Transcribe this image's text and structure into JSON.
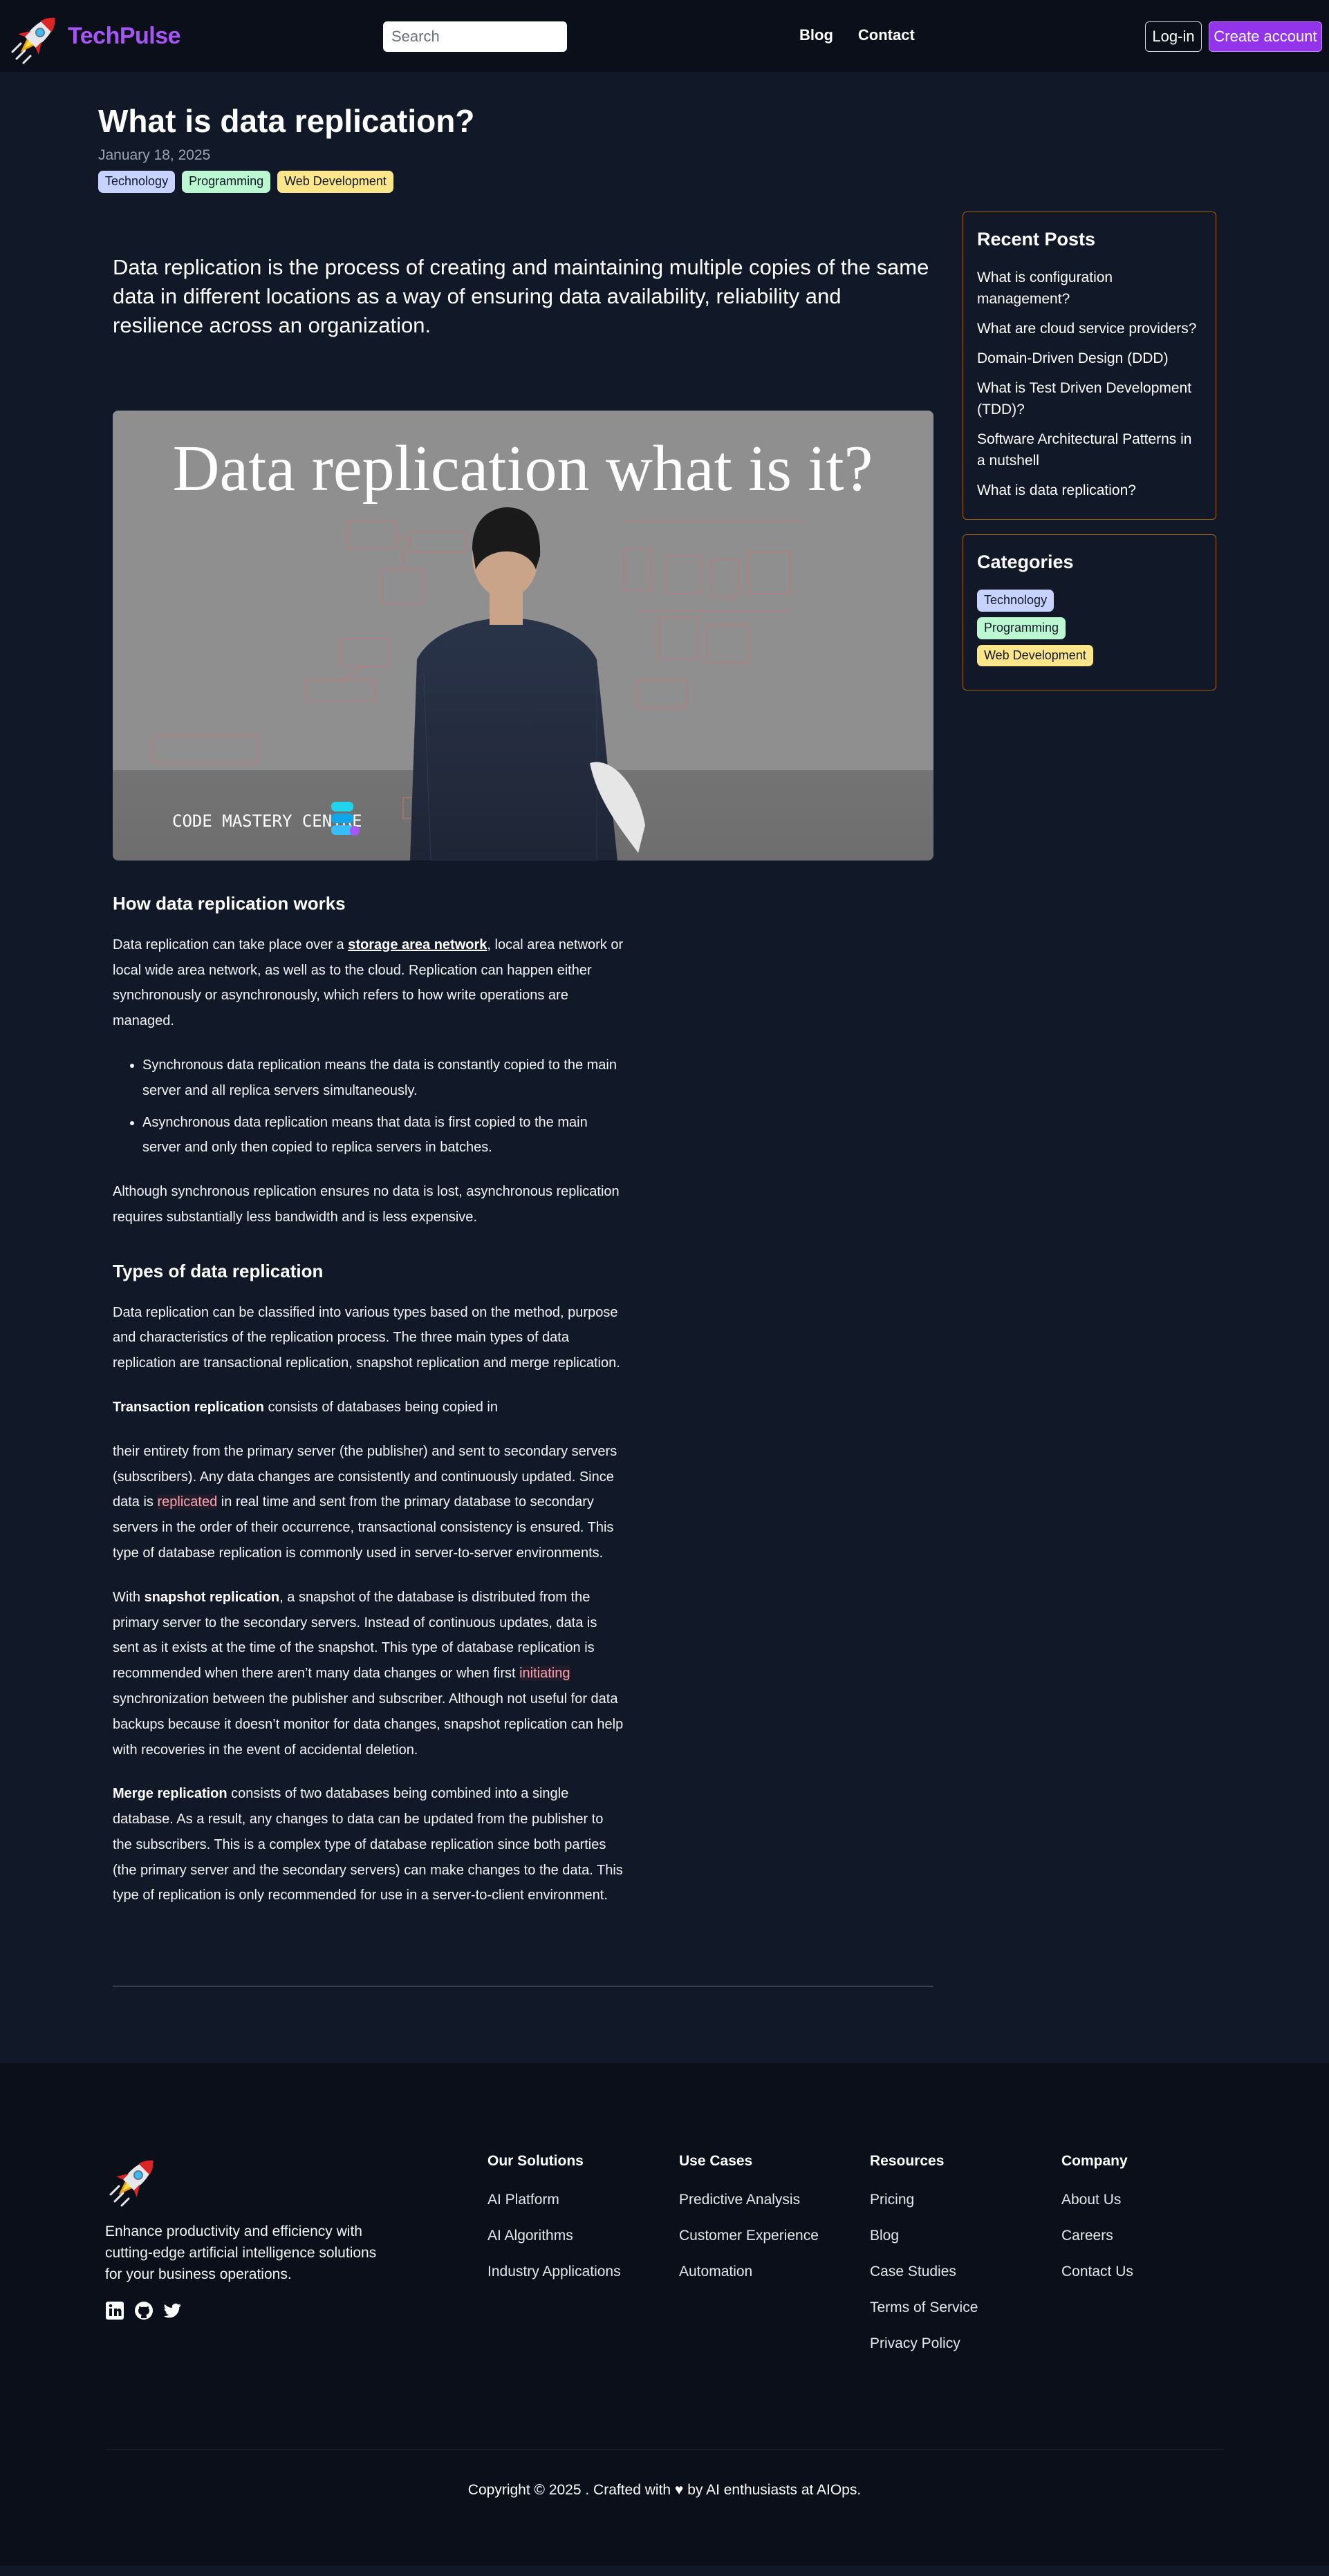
{
  "nav": {
    "brand": "TechPulse",
    "search_placeholder": "Search",
    "links": [
      "Blog",
      "Contact"
    ],
    "login": "Log-in",
    "create_account": "Create account"
  },
  "post": {
    "title": "What is data replication?",
    "date": "January 18, 2025",
    "tags": [
      {
        "label": "Technology",
        "color": "#c7d2fe"
      },
      {
        "label": "Programming",
        "color": "#bbf7d0"
      },
      {
        "label": "Web Development",
        "color": "#fde68a"
      }
    ],
    "intro": "Data replication is the process of creating and maintaining multiple copies of the same data in different locations as a way of ensuring data availability, reliability and resilience across an organization.",
    "hero": {
      "headline": "Data replication what is it?",
      "watermark": "CODE MASTERY CENTRE"
    },
    "section1": {
      "heading": "How data replication works",
      "p1_a": "Data replication can take place over a ",
      "p1_link": "storage area network",
      "p1_b": ", local area network or local wide area network, as well as to the cloud. Replication can happen either synchronously or asynchronously, which refers to how write operations are managed.",
      "bullets": [
        "Synchronous data replication means the data is constantly copied to the main server and all replica servers simultaneously.",
        "Asynchronous data replication means that data is first copied to the main server and only then copied to replica servers in batches."
      ],
      "p2": "Although synchronous replication ensures no data is lost, asynchronous replication requires substantially less bandwidth and is less expensive."
    },
    "section2": {
      "heading": "Types of data replication",
      "p1": "Data replication can be classified into various types based on the method, purpose and characteristics of the replication process. The three main types of data replication are transactional replication, snapshot replication and merge replication.",
      "p2_bold": "Transaction replication",
      "p2_rest": " consists of databases being copied in",
      "p3_a": "their entirety from the primary server (the publisher) and sent to secondary servers (subscribers). Any data changes are consistently and continuously updated. Since data is ",
      "p3_hl": "replicated",
      "p3_b": " in real time and sent from the primary database to secondary servers in the order of their occurrence, transactional consistency is ensured. This type of database replication is commonly used in server-to-server environments.",
      "p4_a": "With ",
      "p4_bold": "snapshot replication",
      "p4_b": ", a snapshot of the database is distributed from the primary server to the secondary servers. Instead of continuous updates, data is sent as it exists at the time of the snapshot. This type of database replication is recommended when there aren’t many data changes or when first ",
      "p4_hl": "initiating",
      "p4_c": " synchronization between the publisher and subscriber. Although not useful for data backups because it doesn’t monitor for data changes, snapshot replication can help with recoveries in the event of accidental deletion.",
      "p5_bold": "Merge replication",
      "p5_rest": " consists of two databases being combined into a single database. As a result, any changes to data can be updated from the publisher to the subscribers. This is a complex type of database replication since both parties (the primary server and the secondary servers) can make changes to the data. This type of replication is only recommended for use in a server-to-client environment."
    }
  },
  "sidebar": {
    "recent_title": "Recent Posts",
    "recent": [
      "What is configuration management?",
      "What are cloud service providers?",
      "Domain-Driven Design (DDD)",
      "What is Test Driven Development (TDD)?",
      "Software Architectural Patterns in a nutshell",
      "What is data replication?"
    ],
    "categories_title": "Categories",
    "categories": [
      {
        "label": "Technology",
        "color": "#c7d2fe"
      },
      {
        "label": "Programming",
        "color": "#bbf7d0"
      },
      {
        "label": "Web Development",
        "color": "#fde68a"
      }
    ]
  },
  "footer": {
    "tagline": "Enhance productivity and efficiency with cutting-edge artificial intelligence solutions for your business operations.",
    "columns": [
      {
        "title": "Our Solutions",
        "links": [
          "AI Platform",
          "AI Algorithms",
          "Industry Applications"
        ]
      },
      {
        "title": "Use Cases",
        "links": [
          "Predictive Analysis",
          "Customer Experience",
          "Automation"
        ]
      },
      {
        "title": "Resources",
        "links": [
          "Pricing",
          "Blog",
          "Case Studies",
          "Terms of Service",
          "Privacy Policy"
        ]
      },
      {
        "title": "Company",
        "links": [
          "About Us",
          "Careers",
          "Contact Us"
        ]
      }
    ],
    "copyright": "Copyright © 2025 . Crafted with ♥ by AI enthusiasts at AIOps."
  },
  "colors": {
    "background": "#111827",
    "nav_background": "#0b0f19",
    "brand": "#a855f7",
    "create_button": "#9333ea",
    "sidebar_border": "#a16207"
  }
}
